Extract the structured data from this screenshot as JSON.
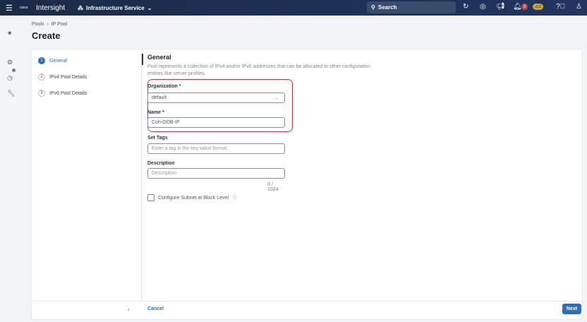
{
  "header": {
    "brand_logo": "cisco",
    "app_name": "Intersight",
    "service": "Infrastructure Service",
    "search_placeholder": "Search",
    "alerts_critical": "0",
    "alerts_warning": "⚠1"
  },
  "breadcrumb": [
    "Pools",
    "IP Pool"
  ],
  "page_title": "Create",
  "steps": [
    {
      "num": "1",
      "label": "General"
    },
    {
      "num": "2",
      "label": "IPv4 Pool Details"
    },
    {
      "num": "3",
      "label": "IPv6 Pool Details"
    }
  ],
  "form": {
    "heading": "General",
    "description": "Pool represents a collection of IPv4 and/or IPv6 addresses that can be allocated to other configuration entities like server profiles.",
    "org_label": "Organization *",
    "org_value": "default",
    "name_label": "Name *",
    "name_value": "Coh-OOB-IP",
    "tags_label": "Set Tags",
    "tags_placeholder": "Enter a tag in the key:value format.",
    "desc_label": "Description",
    "desc_placeholder": "Description",
    "desc_counter": "0 / 1024",
    "subnet_checkbox": "Configure Subnet at Block Level"
  },
  "footer": {
    "cancel": "Cancel",
    "next": "Next"
  }
}
